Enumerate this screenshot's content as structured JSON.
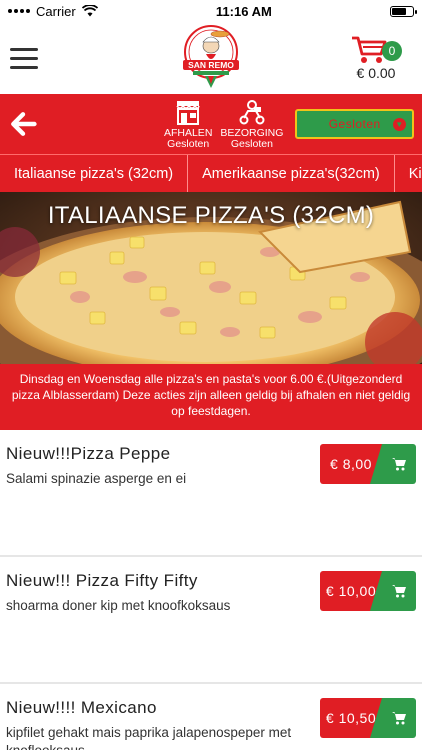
{
  "status_bar": {
    "carrier": "Carrier",
    "time": "11:16 AM"
  },
  "header": {
    "logo_text": "SAN REMO",
    "cart_count": "0",
    "cart_total": "€ 0.00"
  },
  "toolbar": {
    "afhalen_label": "AFHALEN",
    "afhalen_status": "Gesloten",
    "bezorging_label": "BEZORGING",
    "bezorging_status": "Gesloten",
    "status_select": "Gesloten"
  },
  "categories": [
    {
      "label": "Italiaanse pizza's (32cm)"
    },
    {
      "label": "Amerikaanse pizza's(32cm)"
    },
    {
      "label": "Ki"
    }
  ],
  "hero": {
    "title": "ITALIAANSE PIZZA'S (32CM)"
  },
  "promo": {
    "text": "Dinsdag en Woensdag alle pizza's en pasta's voor 6.00 €.(Uitgezonderd pizza Alblasserdam) Deze acties zijn alleen geldig bij afhalen en niet geldig op feestdagen."
  },
  "products": [
    {
      "name": "Nieuw!!!Pizza Peppe",
      "description": "Salami spinazie asperge en ei",
      "price": "€ 8,00"
    },
    {
      "name": "Nieuw!!! Pizza Fifty Fifty",
      "description": "shoarma doner kip met knoofkoksaus",
      "price": "€ 10,00"
    },
    {
      "name": "Nieuw!!!! Mexicano",
      "description": "kipfilet gehakt mais paprika jalapenospeper met knoflooksaus",
      "price": "€ 10,50"
    }
  ],
  "colors": {
    "brand_red": "#e01e24",
    "brand_green": "#2e9b4a",
    "select_border": "#f0c419"
  },
  "icons": [
    "wifi-icon",
    "battery-icon",
    "hamburger-icon",
    "logo",
    "cart-icon",
    "back-arrow-icon",
    "shop-icon",
    "delivery-scooter-icon",
    "chevron-down-icon",
    "add-to-cart-icon"
  ]
}
